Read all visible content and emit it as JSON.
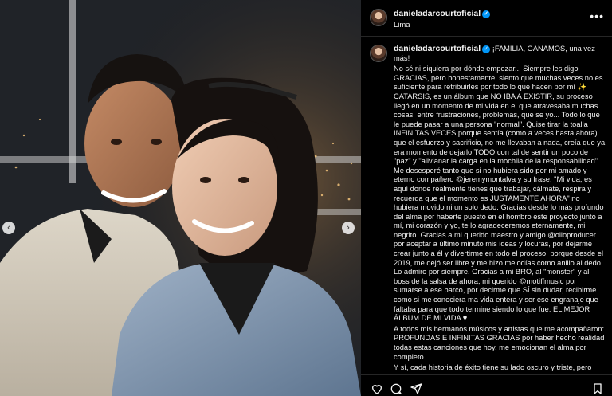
{
  "post": {
    "author": {
      "username": "danieladarcourtoficial",
      "verified": true,
      "location": "Lima"
    },
    "caption": {
      "username": "danieladarcourtoficial",
      "paragraphs": [
        "¡FAMILIA, GANAMOS, una vez más! ",
        "No sé ni siquiera por dónde empezar... Siempre les digo GRACIAS, pero honestamente, siento que muchas veces no es suficiente para retribuirles por todo lo que hacen por mí ✨ CATARSIS, es un álbum que NO IBA A EXISTIR, su proceso llegó en un momento de mi vida en el que atravesaba muchas cosas, entre frustraciones, problemas, que se yo... Todo lo que le puede pasar a una persona \"normal\". Quise tirar la toalla INFINITAS VECES porque sentía (como a veces hasta ahora) que el esfuerzo y sacrificio, no me llevaban a nada, creía que ya era momento de dejarlo TODO con tal de sentir un poco de \"paz\" y \"alivianar la carga en la mochila de la responsabilidad\". Me desesperé tanto que si no hubiera sido por mi amado y eterno compañero @jeremymontalva y su frase: \"Mi vida, es aquí donde realmente tienes que trabajar, cálmate, respira y recuerda que el momento es JUSTAMENTE AHORA\" no hubiera movido ni un solo dedo. Gracias desde lo más profundo del alma por haberte puesto en el hombro este proyecto junto a mí, mi corazón y yo, te lo agradeceremos eternamente, mi negrito. Gracias a mi querido maestro y amigo @oiloproducer por aceptar a último minuto mis ideas y locuras, por dejarme crear junto a él y divertirme en todo el proceso, porque desde el 2019, me dejó ser libre y me hizo melodías como anillo al dedo. Lo admiro por siempre. Gracias a mi BRO, al \"monster\" y al boss de la salsa de ahora, mi querido @motiffmusic por sumarse a ese barco, por decirme que SÍ sin dudar, recibirme como si me conociera ma vida entera y ser ese engranaje que faltaba para que todo termine siendo lo que fue: EL MEJOR ÁLBUM DE MI VIDA ♥",
        "A todos mis hermanos músicos y artistas que me acompañaron: PROFUNDAS E INFINITAS GRACIAS por haber hecho realidad todas estas canciones que hoy, me emocionan el alma por completo.",
        "Y sí, cada historia de éxito tiene su lado oscuro y triste, pero aquí estoy, más fuerte y con ganas de seguir avanzando... con heridas pero con todo. Familia mía, sigan disfrutando de CATARSIS, y de"
      ]
    }
  },
  "photo": {
    "carousel": {
      "prev_symbol": "‹",
      "next_symbol": "›"
    }
  },
  "icons": {
    "more": "•••",
    "verified": "✓"
  },
  "colors": {
    "background": "#000000",
    "verified_blue": "#0095f6",
    "text": "#f5f5f5",
    "divider": "#262626"
  }
}
